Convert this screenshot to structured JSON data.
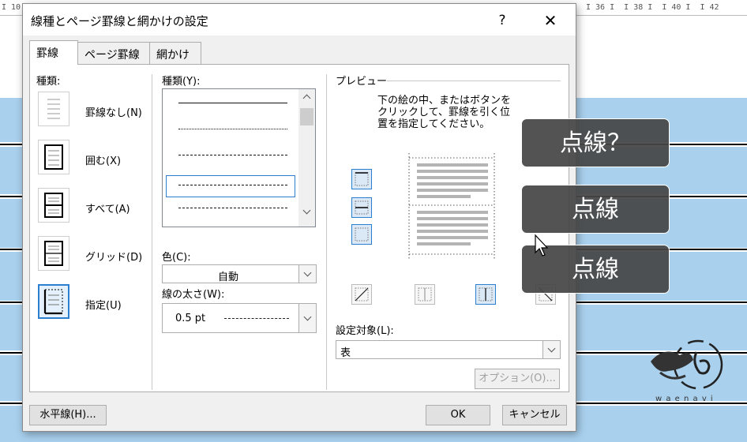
{
  "ruler": {
    "left": "I 10",
    "right": "I 36 I  I 38 I  I 40 I  I 42"
  },
  "dialog": {
    "title": "線種とページ罫線と網かけの設定",
    "help": "?",
    "close": "✕",
    "tabs": [
      "罫線",
      "ページ罫線",
      "網かけ"
    ],
    "settings": {
      "label": "種類:",
      "items": [
        "罫線なし(N)",
        "囲む(X)",
        "すべて(A)",
        "グリッド(D)",
        "指定(U)"
      ]
    },
    "style": {
      "label": "種類(Y):",
      "color_label": "色(C):",
      "color_value": "自動",
      "width_label": "線の太さ(W):",
      "width_value": "0.5 pt"
    },
    "preview": {
      "label": "プレビュー",
      "instructions": [
        "下の絵の中、またはボタンを",
        "クリックして、罫線を引く位",
        "置を指定してください。"
      ],
      "apply_label": "設定対象(L):",
      "apply_value": "表",
      "options_button": "オプション(O)..."
    },
    "footer": {
      "horizontal_line": "水平線(H)...",
      "ok": "OK",
      "cancel": "キャンセル"
    }
  },
  "overlays": [
    "点線？",
    "点線",
    "点線"
  ],
  "logo": {
    "text": "w a e n a v i"
  },
  "colors": {
    "stripe": "#a9d1ee",
    "accent": "#2c7fcf",
    "overlay": "#464646"
  }
}
